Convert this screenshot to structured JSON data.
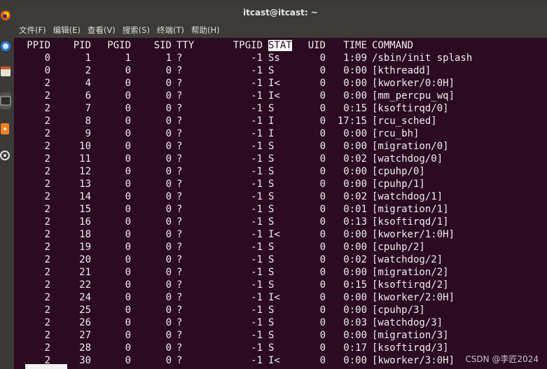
{
  "window": {
    "title": "itcast@itcast: ~",
    "top_hint_left": "",
    "top_hint_right": ""
  },
  "menubar": {
    "items": [
      "文件(F)",
      "编辑(E)",
      "查看(V)",
      "搜索(S)",
      "终端(T)",
      "帮助(H)"
    ]
  },
  "terminal": {
    "header": {
      "ppid": "PPID",
      "pid": "PID",
      "pgid": "PGID",
      "sid": "SID",
      "tty": "TTY",
      "tpgid": "TPGID",
      "stat": "STAT",
      "uid": "UID",
      "time": "TIME",
      "command": "COMMAND"
    },
    "rows": [
      {
        "ppid": "0",
        "pid": "1",
        "pgid": "1",
        "sid": "1",
        "tty": "?",
        "tpgid": "-1",
        "stat": "Ss",
        "uid": "0",
        "time": "1:09",
        "command": "/sbin/init splash"
      },
      {
        "ppid": "0",
        "pid": "2",
        "pgid": "0",
        "sid": "0",
        "tty": "?",
        "tpgid": "-1",
        "stat": "S",
        "uid": "0",
        "time": "0:00",
        "command": "[kthreadd]"
      },
      {
        "ppid": "2",
        "pid": "4",
        "pgid": "0",
        "sid": "0",
        "tty": "?",
        "tpgid": "-1",
        "stat": "I<",
        "uid": "0",
        "time": "0:00",
        "command": "[kworker/0:0H]"
      },
      {
        "ppid": "2",
        "pid": "6",
        "pgid": "0",
        "sid": "0",
        "tty": "?",
        "tpgid": "-1",
        "stat": "I<",
        "uid": "0",
        "time": "0:00",
        "command": "[mm_percpu_wq]"
      },
      {
        "ppid": "2",
        "pid": "7",
        "pgid": "0",
        "sid": "0",
        "tty": "?",
        "tpgid": "-1",
        "stat": "S",
        "uid": "0",
        "time": "0:15",
        "command": "[ksoftirqd/0]"
      },
      {
        "ppid": "2",
        "pid": "8",
        "pgid": "0",
        "sid": "0",
        "tty": "?",
        "tpgid": "-1",
        "stat": "I",
        "uid": "0",
        "time": "17:15",
        "command": "[rcu_sched]"
      },
      {
        "ppid": "2",
        "pid": "9",
        "pgid": "0",
        "sid": "0",
        "tty": "?",
        "tpgid": "-1",
        "stat": "I",
        "uid": "0",
        "time": "0:00",
        "command": "[rcu_bh]"
      },
      {
        "ppid": "2",
        "pid": "10",
        "pgid": "0",
        "sid": "0",
        "tty": "?",
        "tpgid": "-1",
        "stat": "S",
        "uid": "0",
        "time": "0:00",
        "command": "[migration/0]"
      },
      {
        "ppid": "2",
        "pid": "11",
        "pgid": "0",
        "sid": "0",
        "tty": "?",
        "tpgid": "-1",
        "stat": "S",
        "uid": "0",
        "time": "0:02",
        "command": "[watchdog/0]"
      },
      {
        "ppid": "2",
        "pid": "12",
        "pgid": "0",
        "sid": "0",
        "tty": "?",
        "tpgid": "-1",
        "stat": "S",
        "uid": "0",
        "time": "0:00",
        "command": "[cpuhp/0]"
      },
      {
        "ppid": "2",
        "pid": "13",
        "pgid": "0",
        "sid": "0",
        "tty": "?",
        "tpgid": "-1",
        "stat": "S",
        "uid": "0",
        "time": "0:00",
        "command": "[cpuhp/1]"
      },
      {
        "ppid": "2",
        "pid": "14",
        "pgid": "0",
        "sid": "0",
        "tty": "?",
        "tpgid": "-1",
        "stat": "S",
        "uid": "0",
        "time": "0:02",
        "command": "[watchdog/1]"
      },
      {
        "ppid": "2",
        "pid": "15",
        "pgid": "0",
        "sid": "0",
        "tty": "?",
        "tpgid": "-1",
        "stat": "S",
        "uid": "0",
        "time": "0:01",
        "command": "[migration/1]"
      },
      {
        "ppid": "2",
        "pid": "16",
        "pgid": "0",
        "sid": "0",
        "tty": "?",
        "tpgid": "-1",
        "stat": "S",
        "uid": "0",
        "time": "0:13",
        "command": "[ksoftirqd/1]"
      },
      {
        "ppid": "2",
        "pid": "18",
        "pgid": "0",
        "sid": "0",
        "tty": "?",
        "tpgid": "-1",
        "stat": "I<",
        "uid": "0",
        "time": "0:00",
        "command": "[kworker/1:0H]"
      },
      {
        "ppid": "2",
        "pid": "19",
        "pgid": "0",
        "sid": "0",
        "tty": "?",
        "tpgid": "-1",
        "stat": "S",
        "uid": "0",
        "time": "0:00",
        "command": "[cpuhp/2]"
      },
      {
        "ppid": "2",
        "pid": "20",
        "pgid": "0",
        "sid": "0",
        "tty": "?",
        "tpgid": "-1",
        "stat": "S",
        "uid": "0",
        "time": "0:02",
        "command": "[watchdog/2]"
      },
      {
        "ppid": "2",
        "pid": "21",
        "pgid": "0",
        "sid": "0",
        "tty": "?",
        "tpgid": "-1",
        "stat": "S",
        "uid": "0",
        "time": "0:00",
        "command": "[migration/2]"
      },
      {
        "ppid": "2",
        "pid": "22",
        "pgid": "0",
        "sid": "0",
        "tty": "?",
        "tpgid": "-1",
        "stat": "S",
        "uid": "0",
        "time": "0:15",
        "command": "[ksoftirqd/2]"
      },
      {
        "ppid": "2",
        "pid": "24",
        "pgid": "0",
        "sid": "0",
        "tty": "?",
        "tpgid": "-1",
        "stat": "I<",
        "uid": "0",
        "time": "0:00",
        "command": "[kworker/2:0H]"
      },
      {
        "ppid": "2",
        "pid": "25",
        "pgid": "0",
        "sid": "0",
        "tty": "?",
        "tpgid": "-1",
        "stat": "S",
        "uid": "0",
        "time": "0:00",
        "command": "[cpuhp/3]"
      },
      {
        "ppid": "2",
        "pid": "26",
        "pgid": "0",
        "sid": "0",
        "tty": "?",
        "tpgid": "-1",
        "stat": "S",
        "uid": "0",
        "time": "0:03",
        "command": "[watchdog/3]"
      },
      {
        "ppid": "2",
        "pid": "27",
        "pgid": "0",
        "sid": "0",
        "tty": "?",
        "tpgid": "-1",
        "stat": "S",
        "uid": "0",
        "time": "0:00",
        "command": "[migration/3]"
      },
      {
        "ppid": "2",
        "pid": "28",
        "pgid": "0",
        "sid": "0",
        "tty": "?",
        "tpgid": "-1",
        "stat": "S",
        "uid": "0",
        "time": "0:17",
        "command": "[ksoftirqd/3]"
      },
      {
        "ppid": "2",
        "pid": "30",
        "pgid": "0",
        "sid": "0",
        "tty": "?",
        "tpgid": "-1",
        "stat": "I<",
        "uid": "0",
        "time": "0:00",
        "command": "[kworker/3:0H]"
      }
    ]
  },
  "watermark": "CSDN @李匠2024",
  "colors": {
    "terminal_bg": "#2c0a22",
    "terminal_fg": "#eeeeec",
    "chrome_bg": "#3c3b37",
    "dock_bg": "#3b3a38"
  },
  "dock": {
    "icons": [
      "firefox-icon",
      "thunderbird-icon",
      "files-icon",
      "terminal-icon",
      "software-icon",
      "settings-icon"
    ]
  }
}
